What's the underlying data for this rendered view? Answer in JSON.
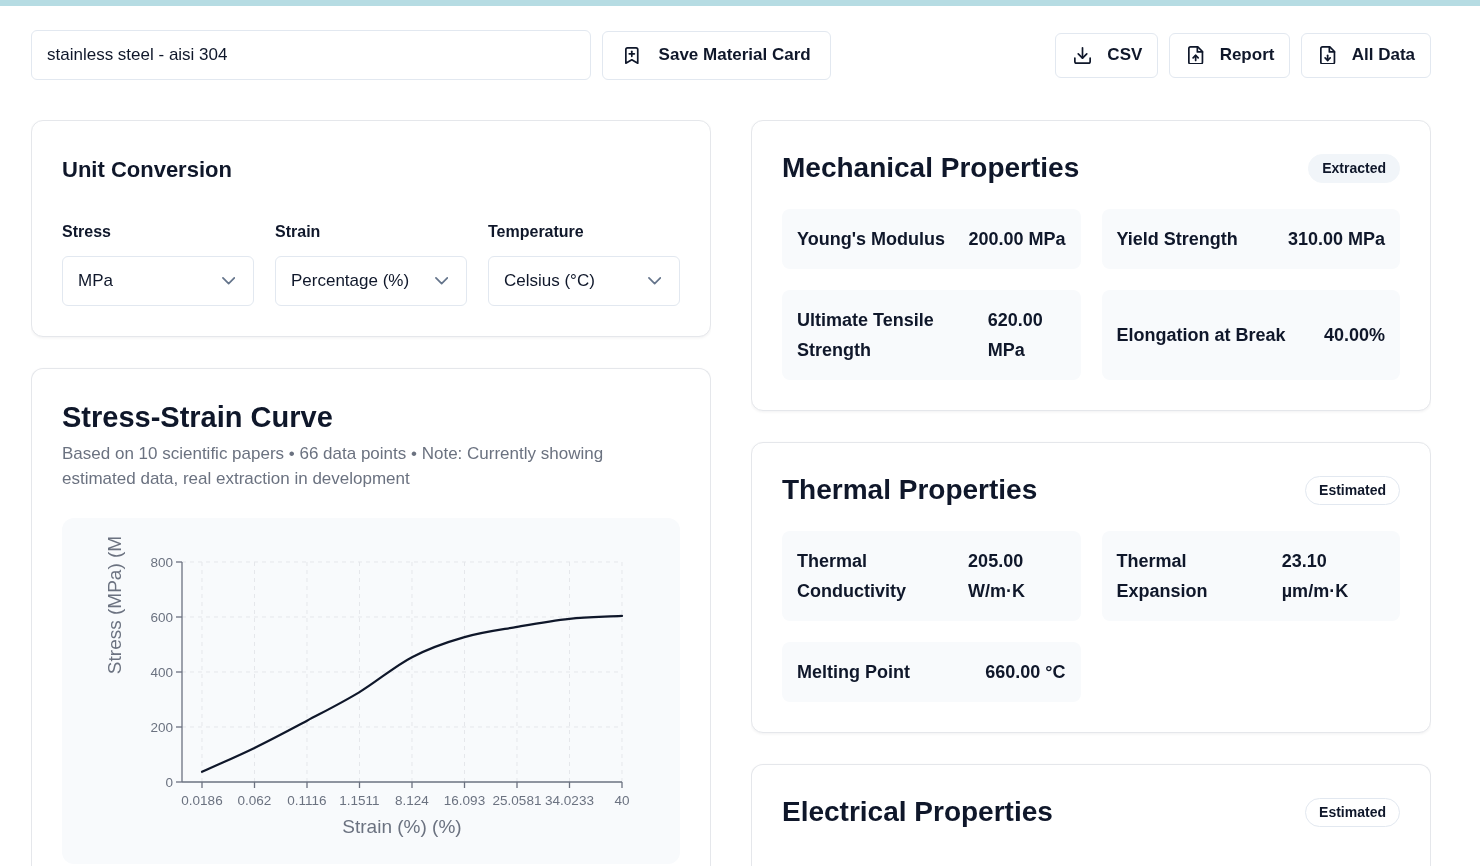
{
  "search": {
    "value": "stainless steel - aisi 304"
  },
  "save_button": {
    "label": "Save Material Card"
  },
  "export_buttons": [
    {
      "label": "CSV"
    },
    {
      "label": "Report"
    },
    {
      "label": "All Data"
    }
  ],
  "unit_conversion": {
    "title": "Unit Conversion",
    "fields": [
      {
        "label": "Stress",
        "value": "MPa"
      },
      {
        "label": "Strain",
        "value": "Percentage (%)"
      },
      {
        "label": "Temperature",
        "value": "Celsius (°C)"
      }
    ]
  },
  "stress_strain": {
    "title": "Stress-Strain Curve",
    "subtitle": "Based on 10 scientific papers • 66 data points • Note: Currently showing estimated data, real extraction in development",
    "chart_data": {
      "type": "line",
      "xlabel": "Strain (%) (%)",
      "ylabel": "Stress (MPa) (M",
      "categories": [
        "0.0186",
        "0.062",
        "0.1116",
        "1.1511",
        "8.124",
        "16.093",
        "25.0581",
        "34.0233",
        "40"
      ],
      "series": [
        {
          "color": "#0f172a",
          "values": [
            37,
            124,
            223,
            327,
            454,
            527,
            564,
            593,
            604
          ]
        }
      ],
      "ylim": [
        0,
        800
      ],
      "yticks": [
        0,
        200,
        400,
        600,
        800
      ],
      "grid": true
    }
  },
  "property_groups": [
    {
      "title": "Mechanical Properties",
      "badge": {
        "label": "Extracted",
        "kind": "extracted"
      },
      "properties": [
        {
          "label": "Young's Modulus",
          "value": "200.00 MPa"
        },
        {
          "label": "Yield Strength",
          "value": "310.00 MPa"
        },
        {
          "label": "Ultimate Tensile Strength",
          "value": "620.00 MPa"
        },
        {
          "label": "Elongation at Break",
          "value": "40.00%"
        }
      ]
    },
    {
      "title": "Thermal Properties",
      "badge": {
        "label": "Estimated",
        "kind": "estimated"
      },
      "properties": [
        {
          "label": "Thermal Conductivity",
          "value": "205.00 W/m·K"
        },
        {
          "label": "Thermal Expansion",
          "value": "23.10 µm/m·K"
        },
        {
          "label": "Melting Point",
          "value": "660.00 °C"
        }
      ]
    },
    {
      "title": "Electrical Properties",
      "badge": {
        "label": "Estimated",
        "kind": "estimated"
      }
    }
  ]
}
